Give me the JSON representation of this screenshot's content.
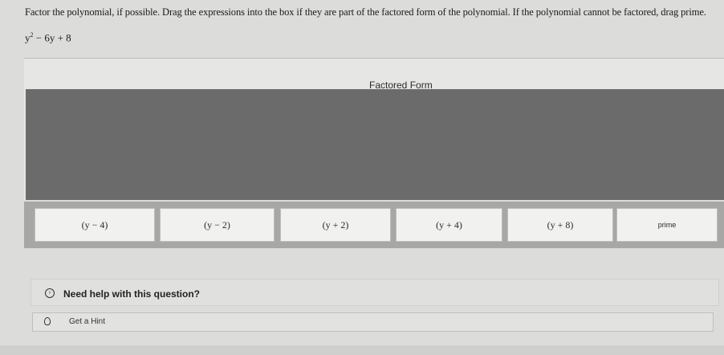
{
  "question": {
    "prompt": "Factor the polynomial, if possible. Drag the expressions into the box if they are part of the factored form of the polynomial. If the polynomial cannot be factored, drag prime.",
    "poly_base": "y",
    "poly_exp": "2",
    "poly_rest": " − 6y + 8"
  },
  "dropzone": {
    "title": "Factored Form"
  },
  "tiles": [
    "(y − 4)",
    "(y − 2)",
    "(y + 2)",
    "(y + 4)",
    "(y + 8)",
    "prime"
  ],
  "help": {
    "label": "Need help with this question?"
  },
  "hint": {
    "label": "Get a Hint"
  }
}
